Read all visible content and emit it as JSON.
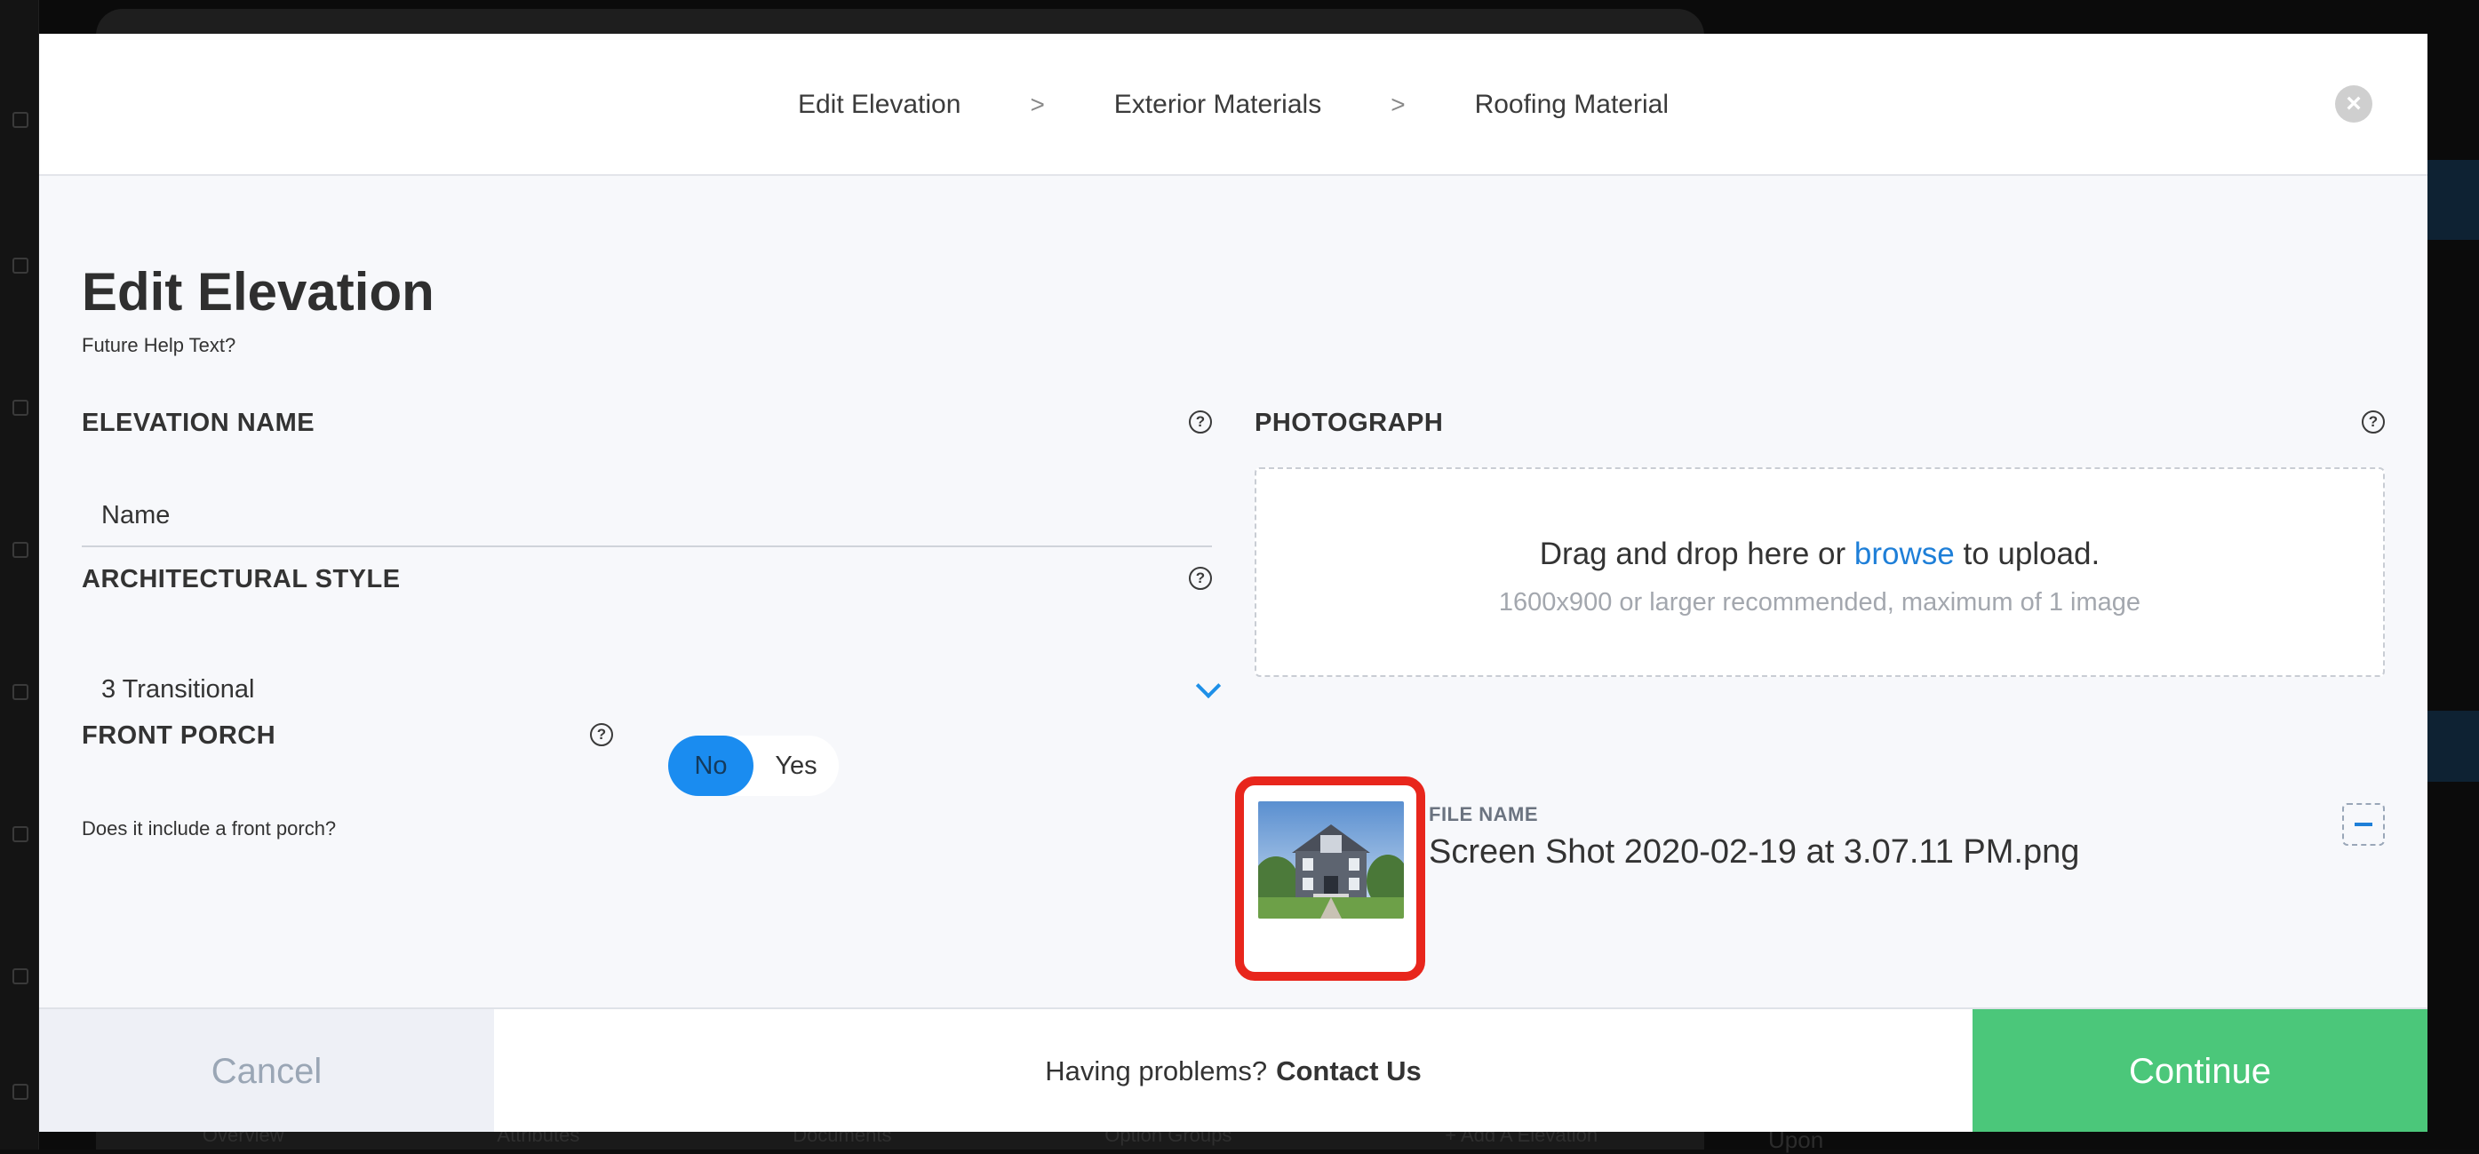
{
  "background": {
    "tabs": [
      "Overview",
      "Attributes",
      "Documents",
      "Option Groups",
      "+ Add A Elevation"
    ],
    "right_text": "Upon"
  },
  "modal": {
    "breadcrumb": {
      "items": [
        "Edit Elevation",
        "Exterior Materials",
        "Roofing Material"
      ],
      "separator": ">"
    },
    "close_symbol": "×",
    "title": "Edit Elevation",
    "subtitle": "Future Help Text?",
    "elevation_name": {
      "label": "ELEVATION NAME",
      "placeholder": "Name",
      "value": ""
    },
    "architectural_style": {
      "label": "ARCHITECTURAL STYLE",
      "selected": "3 Transitional"
    },
    "front_porch": {
      "label": "FRONT PORCH",
      "hint": "Does it include a front porch?",
      "options": [
        "No",
        "Yes"
      ],
      "selected": "No"
    },
    "photograph": {
      "label": "PHOTOGRAPH",
      "drop_prefix": "Drag and drop here or",
      "drop_link": "browse",
      "drop_suffix": "to upload.",
      "recommendation": "1600x900 or larger recommended, maximum of 1 image",
      "file_label": "FILE NAME",
      "file_name": "Screen Shot 2020-02-19 at 3.07.11 PM.png"
    },
    "help_symbol": "?",
    "footer": {
      "cancel": "Cancel",
      "help_prefix": "Having problems?",
      "help_link": "Contact Us",
      "continue": "Continue"
    }
  },
  "colors": {
    "accent_blue": "#1a8cf0",
    "continue_green": "#4bc77a",
    "highlight_red": "#e8261c",
    "link_blue": "#1e7fd8"
  }
}
